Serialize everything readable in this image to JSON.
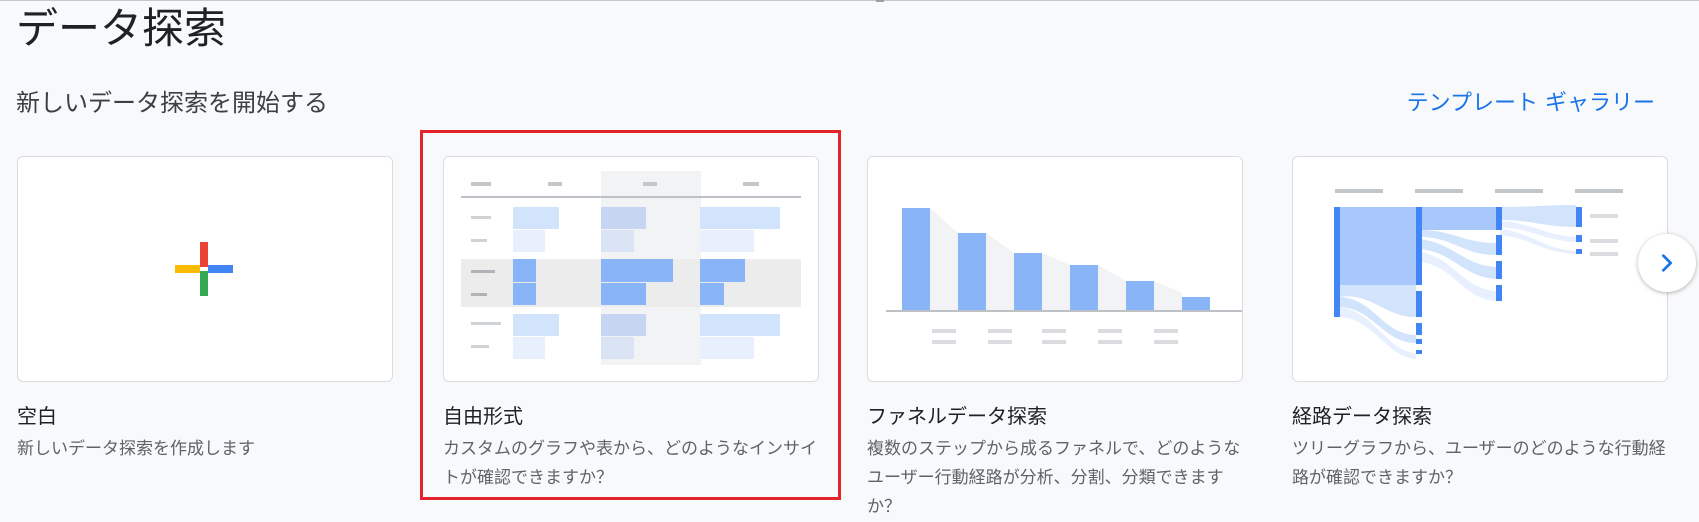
{
  "header": {
    "title": "データ探索"
  },
  "section": {
    "title": "新しいデータ探索を開始する",
    "gallery_link": "テンプレート ギャラリー"
  },
  "cards": [
    {
      "title": "空白",
      "description": "新しいデータ探索を作成します",
      "icon": "plus-icon"
    },
    {
      "title": "自由形式",
      "description": "カスタムのグラフや表から、どのようなインサイトが確認できますか？",
      "highlighted": true
    },
    {
      "title": "ファネルデータ探索",
      "description": "複数のステップから成るファネルで、どのようなユーザー行動経路が分析、分割、分類できますか？"
    },
    {
      "title": "経路データ探索",
      "description": "ツリーグラフから、ユーザーのどのような行動経路が確認できますか？"
    }
  ],
  "colors": {
    "highlight": "#e3242b",
    "link": "#1a73e8",
    "plus_red": "#ea4335",
    "plus_blue": "#4285f4",
    "plus_green": "#34a853",
    "plus_yellow": "#fbbc04",
    "bar_blue": "#8ab4f8",
    "bar_light_blue": "#d2e3fc"
  },
  "icons": {
    "next": "chevron-right-icon"
  }
}
